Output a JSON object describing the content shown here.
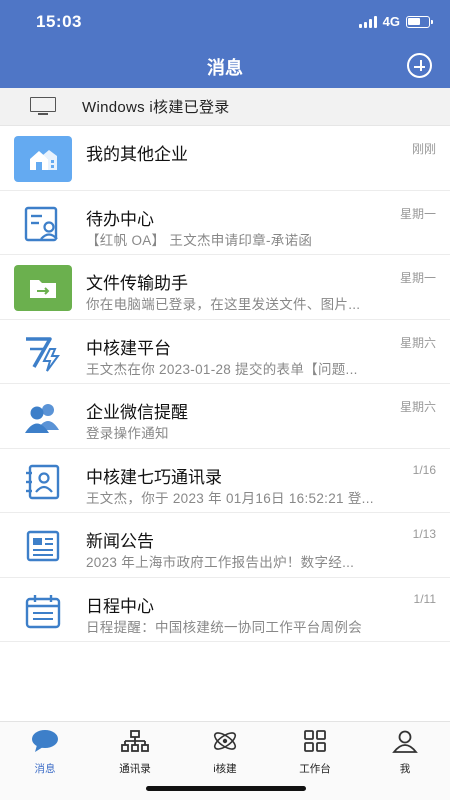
{
  "status_bar": {
    "time": "15:03",
    "network": "4G"
  },
  "nav": {
    "title": "消息"
  },
  "login_bar": {
    "text": "Windows i核建已登录"
  },
  "messages": [
    {
      "title": "我的其他企业",
      "preview": "",
      "time": "刚刚",
      "icon": "building-icon"
    },
    {
      "title": "待办中心",
      "preview": "【红帆 OA】 王文杰申请印章-承诺函",
      "time": "星期一",
      "icon": "todo-icon"
    },
    {
      "title": "文件传输助手",
      "preview": "你在电脑端已登录，在这里发送文件、图片...",
      "time": "星期一",
      "icon": "folder-transfer-icon"
    },
    {
      "title": "中核建平台",
      "preview": "王文杰在你 2023-01-28 提交的表单【问题...",
      "time": "星期六",
      "icon": "platform-logo-icon"
    },
    {
      "title": "企业微信提醒",
      "preview": "登录操作通知",
      "time": "星期六",
      "icon": "users-icon"
    },
    {
      "title": "中核建七巧通讯录",
      "preview": "王文杰，你于 2023 年 01月16日 16:52:21 登...",
      "time": "1/16",
      "icon": "contact-book-icon"
    },
    {
      "title": "新闻公告",
      "preview": "2023 年上海市政府工作报告出炉！数字经...",
      "time": "1/13",
      "icon": "newspaper-icon"
    },
    {
      "title": "日程中心",
      "preview": "日程提醒：中国核建统一协同工作平台周例会",
      "time": "1/11",
      "icon": "calendar-icon"
    }
  ],
  "tabs": [
    {
      "label": "消息",
      "icon": "chat-bubble-icon",
      "active": true
    },
    {
      "label": "通讯录",
      "icon": "org-chart-icon",
      "active": false
    },
    {
      "label": "i核建",
      "icon": "atom-icon",
      "active": false
    },
    {
      "label": "工作台",
      "icon": "grid-icon",
      "active": false
    },
    {
      "label": "我",
      "icon": "person-icon",
      "active": false
    }
  ],
  "colors": {
    "header": "#4f76c6",
    "accent": "#3d6dc7",
    "icon_blue": "#3d7fc9"
  }
}
